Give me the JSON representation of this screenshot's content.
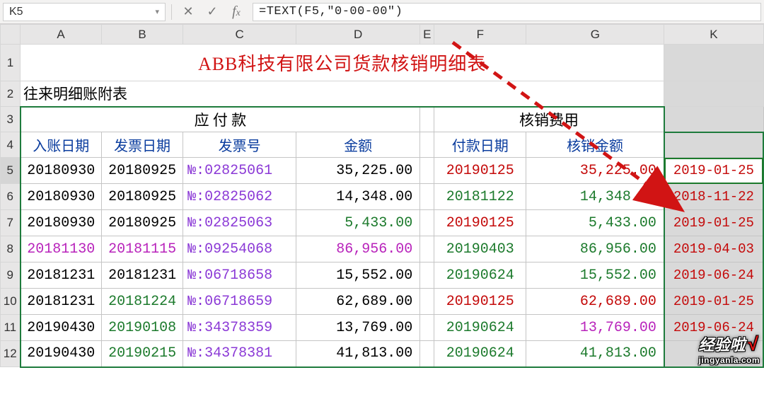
{
  "active_cell": "K5",
  "formula": "=TEXT(F5,\"0-00-00\")",
  "col_headers": [
    "A",
    "B",
    "C",
    "D",
    "E",
    "F",
    "G",
    "K"
  ],
  "row_headers": [
    "1",
    "2",
    "3",
    "4",
    "5",
    "6",
    "7",
    "8",
    "9",
    "10",
    "11",
    "12"
  ],
  "title": "ABB科技有限公司货款核销明细表",
  "subtitle": "往来明细账附表",
  "section_left": "应 付 款",
  "section_right": "核销费用",
  "headers": {
    "A": "入账日期",
    "B": "发票日期",
    "C": "发票号",
    "D": "金额",
    "F": "付款日期",
    "G": "核销金额"
  },
  "rows": [
    {
      "A": "20180930",
      "B": "20180925",
      "C": "№:02825061",
      "D": "35,225.00",
      "F": "20190125",
      "G": "35,225.00",
      "K": "2019-01-25",
      "Fcolor": "red",
      "Gcolor": "red"
    },
    {
      "A": "20180930",
      "B": "20180925",
      "C": "№:02825062",
      "D": "14,348.00",
      "F": "20181122",
      "G": "14,348.00",
      "K": "2018-11-22",
      "Fcolor": "green",
      "Gcolor": "green"
    },
    {
      "A": "20180930",
      "B": "20180925",
      "C": "№:02825063",
      "D": "5,433.00",
      "Dcolor": "green",
      "F": "20190125",
      "G": "5,433.00",
      "K": "2019-01-25",
      "Fcolor": "red",
      "Gcolor": "green"
    },
    {
      "A": "20181130",
      "B": "20181115",
      "C": "№:09254068",
      "D": "86,956.00",
      "F": "20190403",
      "G": "86,956.00",
      "K": "2019-04-03",
      "Arowcolor": "magenta",
      "Fcolor": "green",
      "Gcolor": "green"
    },
    {
      "A": "20181231",
      "B": "20181231",
      "C": "№:06718658",
      "D": "15,552.00",
      "F": "20190624",
      "G": "15,552.00",
      "K": "2019-06-24",
      "Fcolor": "green",
      "Gcolor": "green"
    },
    {
      "A": "20181231",
      "B": "20181224",
      "C": "№:06718659",
      "D": "62,689.00",
      "F": "20190125",
      "G": "62,689.00",
      "K": "2019-01-25",
      "Bcolor": "green",
      "Fcolor": "red",
      "Gcolor": "red"
    },
    {
      "A": "20190430",
      "B": "20190108",
      "C": "№:34378359",
      "D": "13,769.00",
      "F": "20190624",
      "G": "13,769.00",
      "K": "2019-06-24",
      "Bcolor": "green",
      "Fcolor": "green",
      "Gcolor": "magenta"
    },
    {
      "A": "20190430",
      "B": "20190215",
      "C": "№:34378381",
      "D": "41,813.00",
      "F": "20190624",
      "G": "41,813.00",
      "K": "",
      "Bcolor": "green",
      "Fcolor": "green",
      "Gcolor": "green"
    }
  ],
  "watermark": {
    "main": "经验啦",
    "tick": "√",
    "sub": "jingyanla.com"
  }
}
